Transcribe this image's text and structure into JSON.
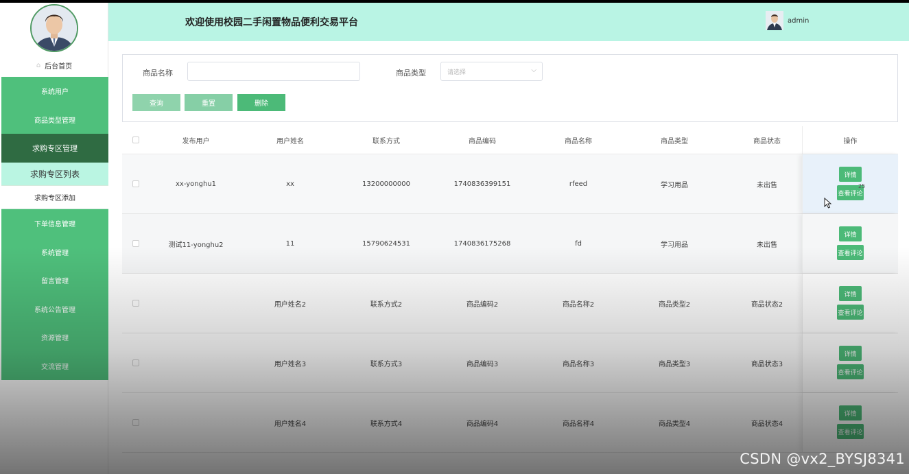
{
  "header": {
    "title": "欢迎使用校园二手闲置物品便利交易平台",
    "username": "admin"
  },
  "sidebar": {
    "home_label": "后台首页",
    "menu": [
      {
        "label": "系统用户",
        "state": "normal"
      },
      {
        "label": "商品类型管理",
        "state": "normal"
      },
      {
        "label": "求购专区管理",
        "state": "active"
      },
      {
        "label": "求购专区列表",
        "state": "submenu-selected"
      },
      {
        "label": "求购专区添加",
        "state": "submenu"
      },
      {
        "label": "下单信息管理",
        "state": "normal"
      },
      {
        "label": "系统管理",
        "state": "normal"
      },
      {
        "label": "留言管理",
        "state": "normal"
      },
      {
        "label": "系统公告管理",
        "state": "normal"
      },
      {
        "label": "资源管理",
        "state": "normal"
      },
      {
        "label": "交流管理",
        "state": "normal"
      }
    ]
  },
  "search": {
    "name_label": "商品名称",
    "name_value": "",
    "type_label": "商品类型",
    "type_placeholder": "请选择",
    "query_button": "查询",
    "reset_button": "重置",
    "delete_button": "删除"
  },
  "table": {
    "columns": [
      "发布用户",
      "用户姓名",
      "联系方式",
      "商品编码",
      "商品名称",
      "商品类型",
      "商品状态",
      "操作"
    ],
    "rows": [
      [
        "xx-yonghu1",
        "xx",
        "13200000000",
        "1740836399151",
        "rfeed",
        "学习用品",
        "未出售"
      ],
      [
        "测试11-yonghu2",
        "11",
        "15790624531",
        "1740836175268",
        "fd",
        "学习用品",
        "未出售"
      ],
      [
        "",
        "用户姓名2",
        "联系方式2",
        "商品编码2",
        "商品名称2",
        "商品类型2",
        "商品状态2"
      ],
      [
        "",
        "用户姓名3",
        "联系方式3",
        "商品编码3",
        "商品名称3",
        "商品类型3",
        "商品状态3"
      ],
      [
        "",
        "用户姓名4",
        "联系方式4",
        "商品编码4",
        "商品名称4",
        "商品类型4",
        "商品状态4"
      ]
    ],
    "detail_button": "详情",
    "comments_button": "查看评论",
    "stray_text": "25"
  },
  "watermark": "CSDN @vx2_BYSJ8341",
  "colors": {
    "sidebar_green": "#4fc07c",
    "sidebar_active": "#2f6b42",
    "header_bg": "#b9f4e4",
    "submenu_selected": "#baf5e2",
    "query_btn": "#8fd3ac",
    "reset_btn": "#86cfa6",
    "delete_btn": "#4cba78",
    "op_btn": "#4cba78"
  }
}
